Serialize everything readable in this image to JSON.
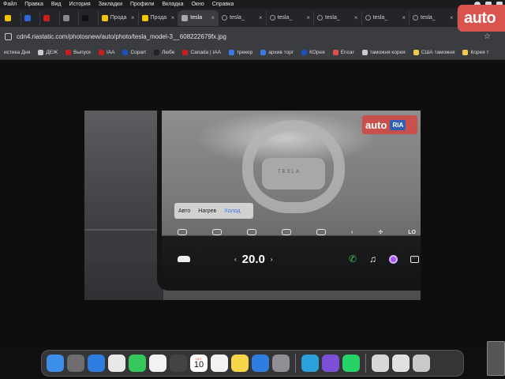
{
  "menubar": {
    "items": [
      "Файл",
      "Правка",
      "Вид",
      "История",
      "Закладки",
      "Профили",
      "Вкладка",
      "Окно",
      "Справка"
    ]
  },
  "tabs": [
    {
      "label": "",
      "fav_color": "#f5c400",
      "size": "small"
    },
    {
      "label": "",
      "fav_color": "#2c66d9",
      "size": "small"
    },
    {
      "label": "",
      "fav_color": "#c81e1e",
      "size": "small"
    },
    {
      "label": "",
      "fav_color": "#888888",
      "size": "small"
    },
    {
      "label": "",
      "fav_color": "#111111",
      "size": "small"
    },
    {
      "label": "Прода",
      "fav_color": "#f5c400",
      "size": "mid"
    },
    {
      "label": "Прода",
      "fav_color": "#f5c400",
      "size": "mid"
    },
    {
      "label": "tesla",
      "fav_color": "#aaaaaa",
      "size": "mid",
      "active": true
    },
    {
      "label": "tesla_",
      "fav_color": "",
      "size": "wide"
    },
    {
      "label": "tesla_",
      "fav_color": "",
      "size": "wide"
    },
    {
      "label": "tesla_",
      "fav_color": "",
      "size": "wide"
    },
    {
      "label": "tesla_",
      "fav_color": "",
      "size": "wide"
    },
    {
      "label": "tesla_",
      "fav_color": "",
      "size": "wide"
    },
    {
      "label": "tesla_",
      "fav_color": "",
      "size": "wide"
    }
  ],
  "address": {
    "url": "cdn4.riastatic.com/photosnew/auto/photo/tesla_model-3__608222679fx.jpg"
  },
  "bookmarks": [
    {
      "label": "истика Дня",
      "color": ""
    },
    {
      "label": "ДЕЖ",
      "color": "#cccccc"
    },
    {
      "label": "Выпуск",
      "color": "#c81e1e"
    },
    {
      "label": "IAA",
      "color": "#c81e1e"
    },
    {
      "label": "Copart",
      "color": "#1f4fbf"
    },
    {
      "label": "Любе",
      "color": "#222222"
    },
    {
      "label": "Canada | IAA",
      "color": "#c81e1e"
    },
    {
      "label": "трекер",
      "color": "#3b78e7"
    },
    {
      "label": "архив торг",
      "color": "#3b78e7"
    },
    {
      "label": "КОрея",
      "color": "#1f4fbf"
    },
    {
      "label": "Encar",
      "color": "#e05050"
    },
    {
      "label": "таможня корея",
      "color": "#cccccc"
    },
    {
      "label": "США таможня",
      "color": "#f2c94c"
    },
    {
      "label": "Корея т",
      "color": "#f2c94c"
    }
  ],
  "overlay_logo": "auto",
  "photo": {
    "watermark_auto": "auto",
    "watermark_ria": "RIA",
    "wheel_brand": "TESLA",
    "climate_modes": [
      "Авто",
      "Нагрев",
      "Холод"
    ],
    "selected_mode": "Холод",
    "fan_label": "LO",
    "temperature": "20.0",
    "temp_left_arrow": "‹",
    "temp_right_arrow": "›"
  },
  "dock": {
    "calendar_month": "ОКТ",
    "calendar_day": "10",
    "apps": [
      {
        "name": "finder",
        "color": "#3b8eea"
      },
      {
        "name": "launchpad",
        "color": "#6d6d72"
      },
      {
        "name": "safari",
        "color": "#2f7de1"
      },
      {
        "name": "chrome",
        "color": "#e8e8e8"
      },
      {
        "name": "messages",
        "color": "#34c759"
      },
      {
        "name": "photos",
        "color": "#f2f2f2"
      },
      {
        "name": "calculator",
        "color": "#444444"
      },
      {
        "name": "calendar",
        "color": "#ffffff"
      },
      {
        "name": "reminders",
        "color": "#f2f2f2"
      },
      {
        "name": "notes",
        "color": "#f7d548"
      },
      {
        "name": "app-store",
        "color": "#2f7de1"
      },
      {
        "name": "system-settings",
        "color": "#8e8e93"
      },
      {
        "name": "telegram",
        "color": "#2aa1da"
      },
      {
        "name": "viber",
        "color": "#7b4fd6"
      },
      {
        "name": "whatsapp",
        "color": "#25d366"
      },
      {
        "name": "preview",
        "color": "#d8d8d8"
      },
      {
        "name": "folder",
        "color": "#e0e0e0"
      },
      {
        "name": "trash",
        "color": "#c9c9c9"
      }
    ]
  }
}
